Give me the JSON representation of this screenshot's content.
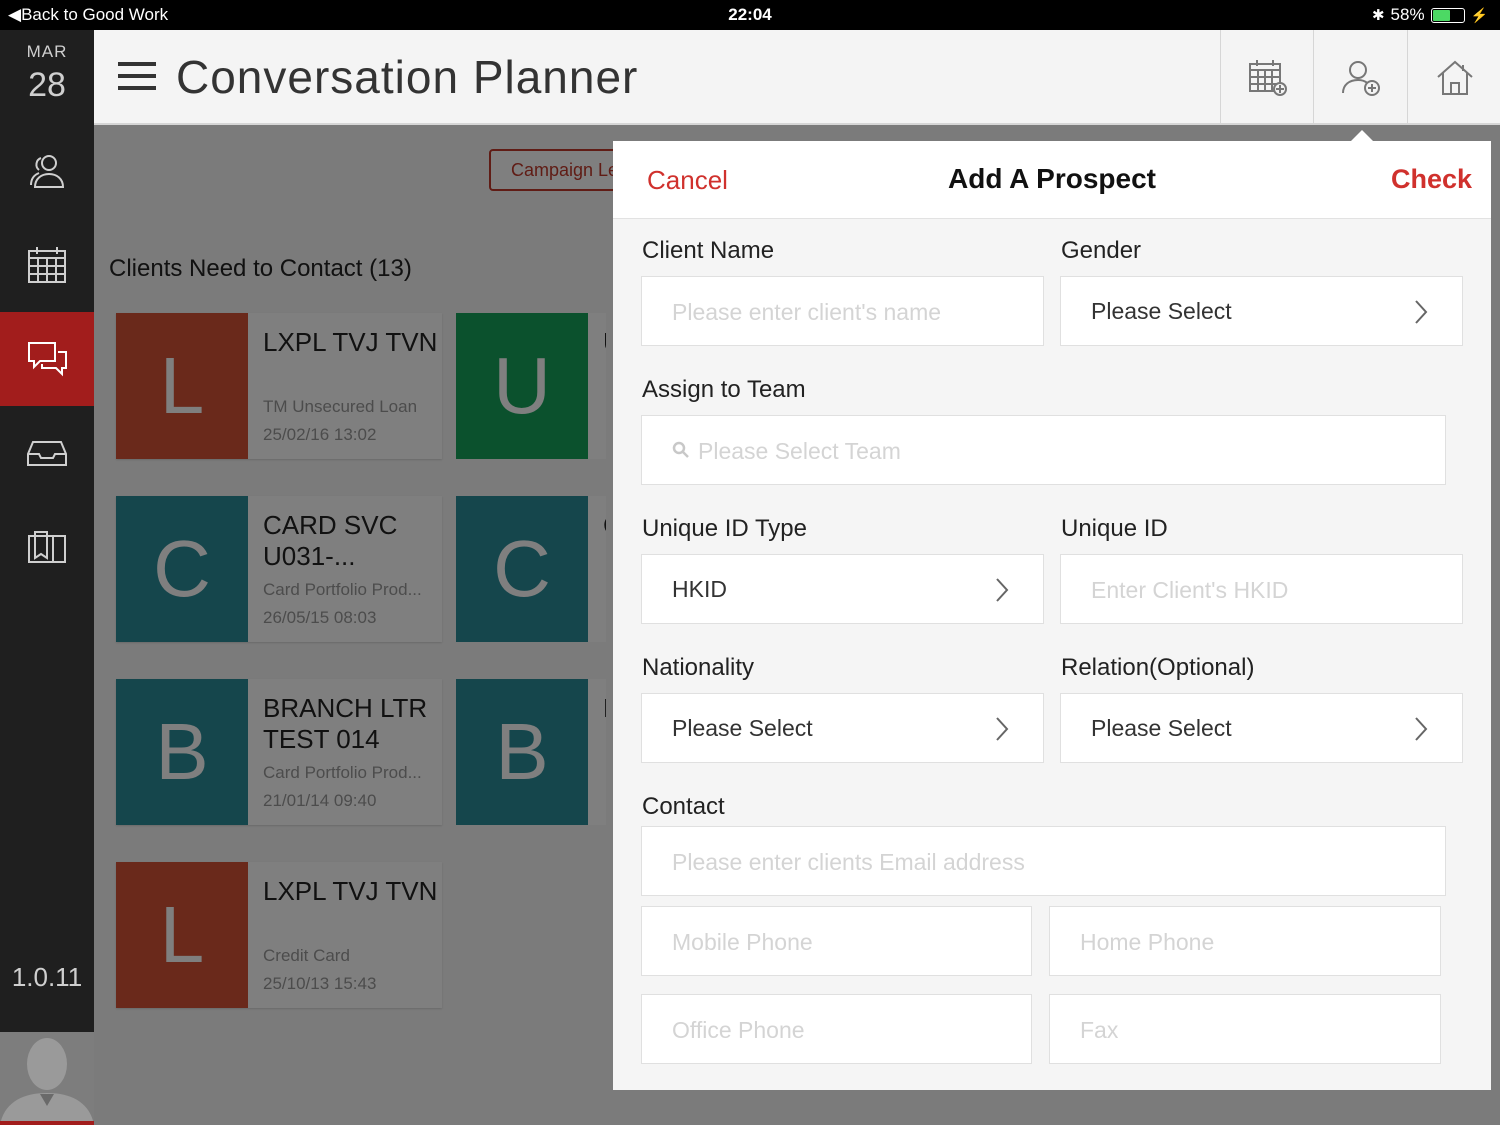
{
  "status_bar": {
    "back": "Back to Good Work",
    "time": "22:04",
    "battery": "58%"
  },
  "nav": {
    "month": "MAR",
    "day": "28",
    "version": "1.0.11"
  },
  "header": {
    "title": "Conversation Planner"
  },
  "content": {
    "campaign_button": "Campaign Le",
    "section_title": "Clients Need to Contact (13)",
    "cards": [
      {
        "letter": "L",
        "name": "LXPL TVJ TVN",
        "sub": "TM Unsecured Loan",
        "ts": "25/02/16 13:02",
        "color": "#d45237"
      },
      {
        "letter": "C",
        "name": "CARD SVC U031-...",
        "sub": "Card Portfolio Prod...",
        "ts": "26/05/15 08:03",
        "color": "#2b8c99"
      },
      {
        "letter": "B",
        "name": "BRANCH LTR TEST 014",
        "sub": "Card Portfolio Prod...",
        "ts": "21/01/14 09:40",
        "color": "#2b8c99"
      },
      {
        "letter": "L",
        "name": "LXPL TVJ TVN",
        "sub": "Credit Card",
        "ts": "25/10/13 15:43",
        "color": "#d45237"
      }
    ],
    "mini_cards": [
      {
        "letter": "U",
        "peek": "U",
        "color": "#17a35a"
      },
      {
        "letter": "C",
        "peek": "C",
        "color": "#2b8c99"
      },
      {
        "letter": "B",
        "peek": "E",
        "color": "#2b8c99"
      }
    ]
  },
  "dialog": {
    "cancel": "Cancel",
    "title": "Add A Prospect",
    "check": "Check",
    "client_name": {
      "label": "Client Name",
      "placeholder": "Please enter client's name"
    },
    "gender": {
      "label": "Gender",
      "value": "Please Select"
    },
    "team": {
      "label": "Assign to Team",
      "placeholder": "Please Select Team"
    },
    "id_type": {
      "label": "Unique ID Type",
      "value": "HKID"
    },
    "unique_id": {
      "label": "Unique ID",
      "placeholder": "Enter Client's HKID"
    },
    "nationality": {
      "label": "Nationality",
      "value": "Please Select"
    },
    "relation": {
      "label": "Relation(Optional)",
      "value": "Please Select"
    },
    "contact": {
      "label": "Contact",
      "email_placeholder": "Please enter clients Email address",
      "mobile_placeholder": "Mobile Phone",
      "home_placeholder": "Home Phone",
      "office_placeholder": "Office Phone",
      "fax_placeholder": "Fax"
    }
  },
  "colors": {
    "accent": "#d0312d",
    "nav_active": "#a21d1c"
  }
}
